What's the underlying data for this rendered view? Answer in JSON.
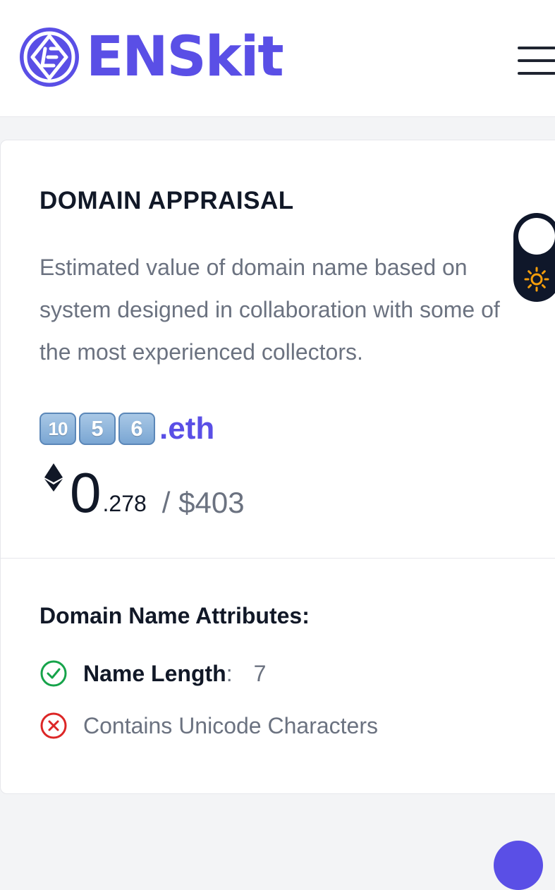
{
  "header": {
    "brand": "ENSkit",
    "icons": {
      "logo": "enskit-logo-icon",
      "menu": "hamburger-menu-icon"
    }
  },
  "appraisal": {
    "title": "DOMAIN APPRAISAL",
    "description": "Estimated value of domain name based on system designed in collaboration with some of the most experienced collectors.",
    "domain": {
      "keycaps": [
        "10",
        "5",
        "6"
      ],
      "tld": ".eth"
    },
    "price": {
      "currency_icon": "ethereum-icon",
      "eth_integer": "0",
      "eth_decimal": ".278",
      "usd": "/ $403"
    }
  },
  "attributes": {
    "heading": "Domain Name Attributes:",
    "items": [
      {
        "icon": "check-circle-icon",
        "status_color": "#16a34a",
        "label": "Name Length",
        "separator": ":",
        "value": "7"
      },
      {
        "icon": "x-circle-icon",
        "status_color": "#dc2626",
        "label": "Contains Unicode Characters"
      }
    ]
  },
  "theme_toggle": {
    "icon": "sun-icon"
  },
  "colors": {
    "brand": "#5a4fe6",
    "text_dark": "#111827",
    "text_muted": "#6b7280",
    "toggle_bg": "#0f172a",
    "sun": "#f59e0b"
  }
}
